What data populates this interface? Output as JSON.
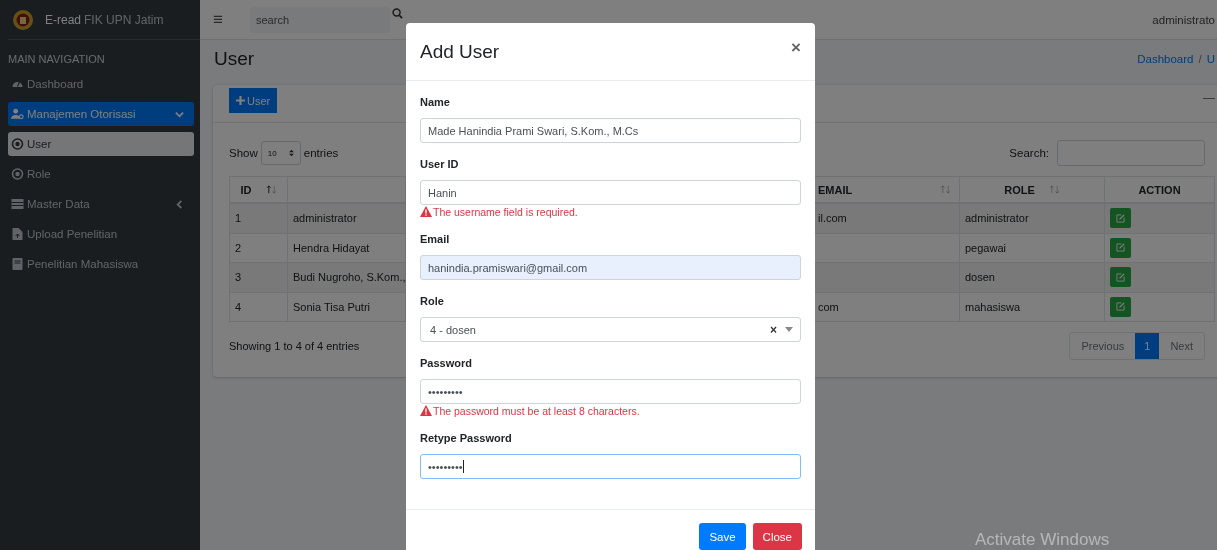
{
  "brand": {
    "title": "E-read",
    "subtitle": "FIK UPN Jatim"
  },
  "topbar": {
    "menu_glyph": "≡",
    "search_placeholder": "search",
    "user": "administrato"
  },
  "sidebar": {
    "header": "MAIN NAVIGATION",
    "items": [
      {
        "label": "Dashboard",
        "kind": "gauge",
        "selected": false
      },
      {
        "label": "Manajemen Otorisasi",
        "kind": "users",
        "selected": true,
        "expanded": true,
        "children": [
          {
            "label": "User",
            "kind": "circle",
            "selected": true
          },
          {
            "label": "Role",
            "kind": "circle",
            "selected": false
          }
        ]
      },
      {
        "label": "Master Data",
        "kind": "table",
        "selected": false,
        "expanded": false
      },
      {
        "label": "Upload Penelitian",
        "kind": "file",
        "selected": false
      },
      {
        "label": "Penelitian Mahasiswa",
        "kind": "book",
        "selected": false
      }
    ]
  },
  "page": {
    "title": "User",
    "breadcrumb": [
      "Dashboard",
      "/",
      "U"
    ]
  },
  "box": {
    "add_button": "User",
    "collapse_glyph": "—"
  },
  "table_controls": {
    "show_label": "Show",
    "page_size": "10",
    "entries_label": "entries",
    "search_label": "Search:"
  },
  "table": {
    "header": {
      "id": {
        "label": "ID",
        "sorted": true
      },
      "email": {
        "label": "EMAIL",
        "sorted": false
      },
      "role": {
        "label": "ROLE",
        "sorted": false
      },
      "action": {
        "label": "ACTION"
      }
    },
    "rows": [
      {
        "id": "1",
        "column_2": "administrator",
        "email": "il.com",
        "role": "administrator"
      },
      {
        "id": "2",
        "column_2": "Hendra Hidayat",
        "role": "pegawai"
      },
      {
        "id": "3",
        "column_2": "Budi Nugroho, S.Kom.,",
        "role": "dosen"
      },
      {
        "id": "4",
        "column_2": "Sonia Tisa Putri",
        "email": "com",
        "role": "mahasiswa"
      }
    ]
  },
  "table_footer": {
    "info": "Showing 1 to 4 of 4 entries",
    "pages": [
      {
        "label": "Previous",
        "selected": false
      },
      {
        "label": "1",
        "selected": true
      },
      {
        "label": "Next",
        "selected": false
      }
    ]
  },
  "modal": {
    "title": "Add User",
    "close_glyph": "×",
    "fields": [
      {
        "label": "Name",
        "kind": "text",
        "value": "Made Hanindia Prami Swari, S.Kom., M.Cs",
        "autofilled": false,
        "focused": false
      },
      {
        "label": "User ID",
        "kind": "text",
        "value": "Hanin",
        "autofilled": false,
        "focused": false,
        "error": "The username field is required."
      },
      {
        "label": "Email",
        "kind": "text",
        "value": "hanindia.pramiswari@gmail.com",
        "autofilled": true,
        "focused": false
      },
      {
        "label": "Role",
        "kind": "select",
        "value": "4 - dosen",
        "clear_glyph": "×",
        "autofilled": false,
        "focused": false
      },
      {
        "label": "Password",
        "kind": "text",
        "value": "•••••••••",
        "autofilled": false,
        "focused": false,
        "error": "The password must be at least 8 characters."
      },
      {
        "label": "Retype Password",
        "kind": "text",
        "value": "•••••••••",
        "autofilled": false,
        "focused": true
      }
    ],
    "buttons": [
      {
        "label": "Save",
        "kind": "primary"
      },
      {
        "label": "Close",
        "kind": "danger"
      }
    ]
  },
  "os_notice": "Activate Windows"
}
